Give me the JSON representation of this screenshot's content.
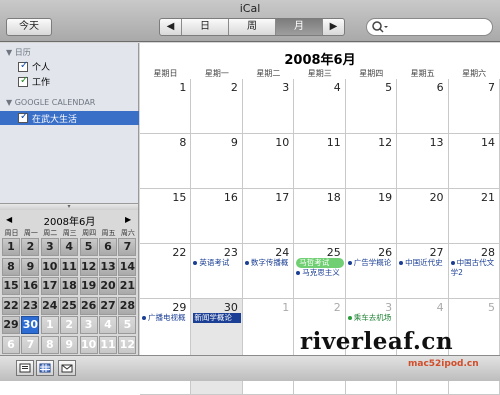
{
  "window": {
    "title": "iCal"
  },
  "toolbar": {
    "today_label": "今天",
    "views": [
      {
        "label": "◀",
        "active": false
      },
      {
        "label": "日",
        "active": false
      },
      {
        "label": "周",
        "active": false
      },
      {
        "label": "月",
        "active": true
      },
      {
        "label": "▶",
        "active": false
      }
    ],
    "search": {
      "placeholder": "",
      "icon": "search-icon"
    }
  },
  "sidebar": {
    "groups": [
      {
        "header": "日历",
        "items": [
          {
            "label": "个人",
            "checked": true
          },
          {
            "label": "工作",
            "checked": true
          }
        ]
      },
      {
        "header": "GOOGLE CALENDAR",
        "items": [
          {
            "label": "在武大生活",
            "checked": true,
            "selected": true
          }
        ]
      }
    ]
  },
  "mini_calendar": {
    "title": "2008年6月",
    "prev": "◀",
    "next": "▶",
    "weekdays": [
      "周日",
      "周一",
      "周二",
      "周三",
      "周四",
      "周五",
      "周六"
    ],
    "rows": [
      [
        "1",
        "2",
        "3",
        "4",
        "5",
        "6",
        "7"
      ],
      [
        "8",
        "9",
        "10",
        "11",
        "12",
        "13",
        "14"
      ],
      [
        "15",
        "16",
        "17",
        "18",
        "19",
        "20",
        "21"
      ],
      [
        "22",
        "23",
        "24",
        "25",
        "26",
        "27",
        "28"
      ],
      [
        "29",
        "30",
        "1",
        "2",
        "3",
        "4",
        "5"
      ],
      [
        "6",
        "7",
        "8",
        "9",
        "10",
        "11",
        "12"
      ]
    ],
    "today": "30"
  },
  "month": {
    "title": "2008年6月",
    "weekdays": [
      "星期日",
      "星期一",
      "星期二",
      "星期三",
      "星期四",
      "星期五",
      "星期六"
    ],
    "weeks": [
      [
        {
          "d": "1"
        },
        {
          "d": "2"
        },
        {
          "d": "3"
        },
        {
          "d": "4"
        },
        {
          "d": "5"
        },
        {
          "d": "6"
        },
        {
          "d": "7"
        }
      ],
      [
        {
          "d": "8"
        },
        {
          "d": "9"
        },
        {
          "d": "10"
        },
        {
          "d": "11"
        },
        {
          "d": "12"
        },
        {
          "d": "13"
        },
        {
          "d": "14"
        }
      ],
      [
        {
          "d": "15"
        },
        {
          "d": "16"
        },
        {
          "d": "17"
        },
        {
          "d": "18"
        },
        {
          "d": "19"
        },
        {
          "d": "20"
        },
        {
          "d": "21"
        }
      ],
      [
        {
          "d": "22"
        },
        {
          "d": "23",
          "events": [
            {
              "text": "英语考试",
              "style": "blue"
            }
          ]
        },
        {
          "d": "24",
          "events": [
            {
              "text": "数字传播概",
              "style": "blue"
            }
          ]
        },
        {
          "d": "25",
          "events": [
            {
              "text": "马哲考试",
              "style": "pill-green"
            },
            {
              "text": "马克思主义",
              "style": "blue"
            }
          ]
        },
        {
          "d": "26",
          "events": [
            {
              "text": "广告学概论",
              "style": "blue"
            }
          ]
        },
        {
          "d": "27",
          "events": [
            {
              "text": "中国近代史",
              "style": "blue"
            }
          ]
        },
        {
          "d": "28",
          "events": [
            {
              "text": "中国古代文学2",
              "style": "blue"
            }
          ]
        }
      ],
      [
        {
          "d": "29",
          "events": [
            {
              "text": "广播电视概",
              "style": "blue"
            }
          ]
        },
        {
          "d": "30",
          "today": true,
          "events": [
            {
              "text": "新闻学概论",
              "style": "pill-blue"
            }
          ]
        },
        {
          "d": "1",
          "other": true
        },
        {
          "d": "2",
          "other": true
        },
        {
          "d": "3",
          "other": true,
          "events": [
            {
              "text": "乘车去机场",
              "style": "green"
            }
          ]
        },
        {
          "d": "4",
          "other": true
        },
        {
          "d": "5",
          "other": true
        }
      ]
    ]
  },
  "bottombar": {
    "buttons": [
      "calendar-list-icon",
      "mini-month-icon",
      "mail-icon"
    ]
  },
  "watermark": {
    "line1": "riverleaf.cn",
    "line2": "mac52ipod.cn"
  }
}
